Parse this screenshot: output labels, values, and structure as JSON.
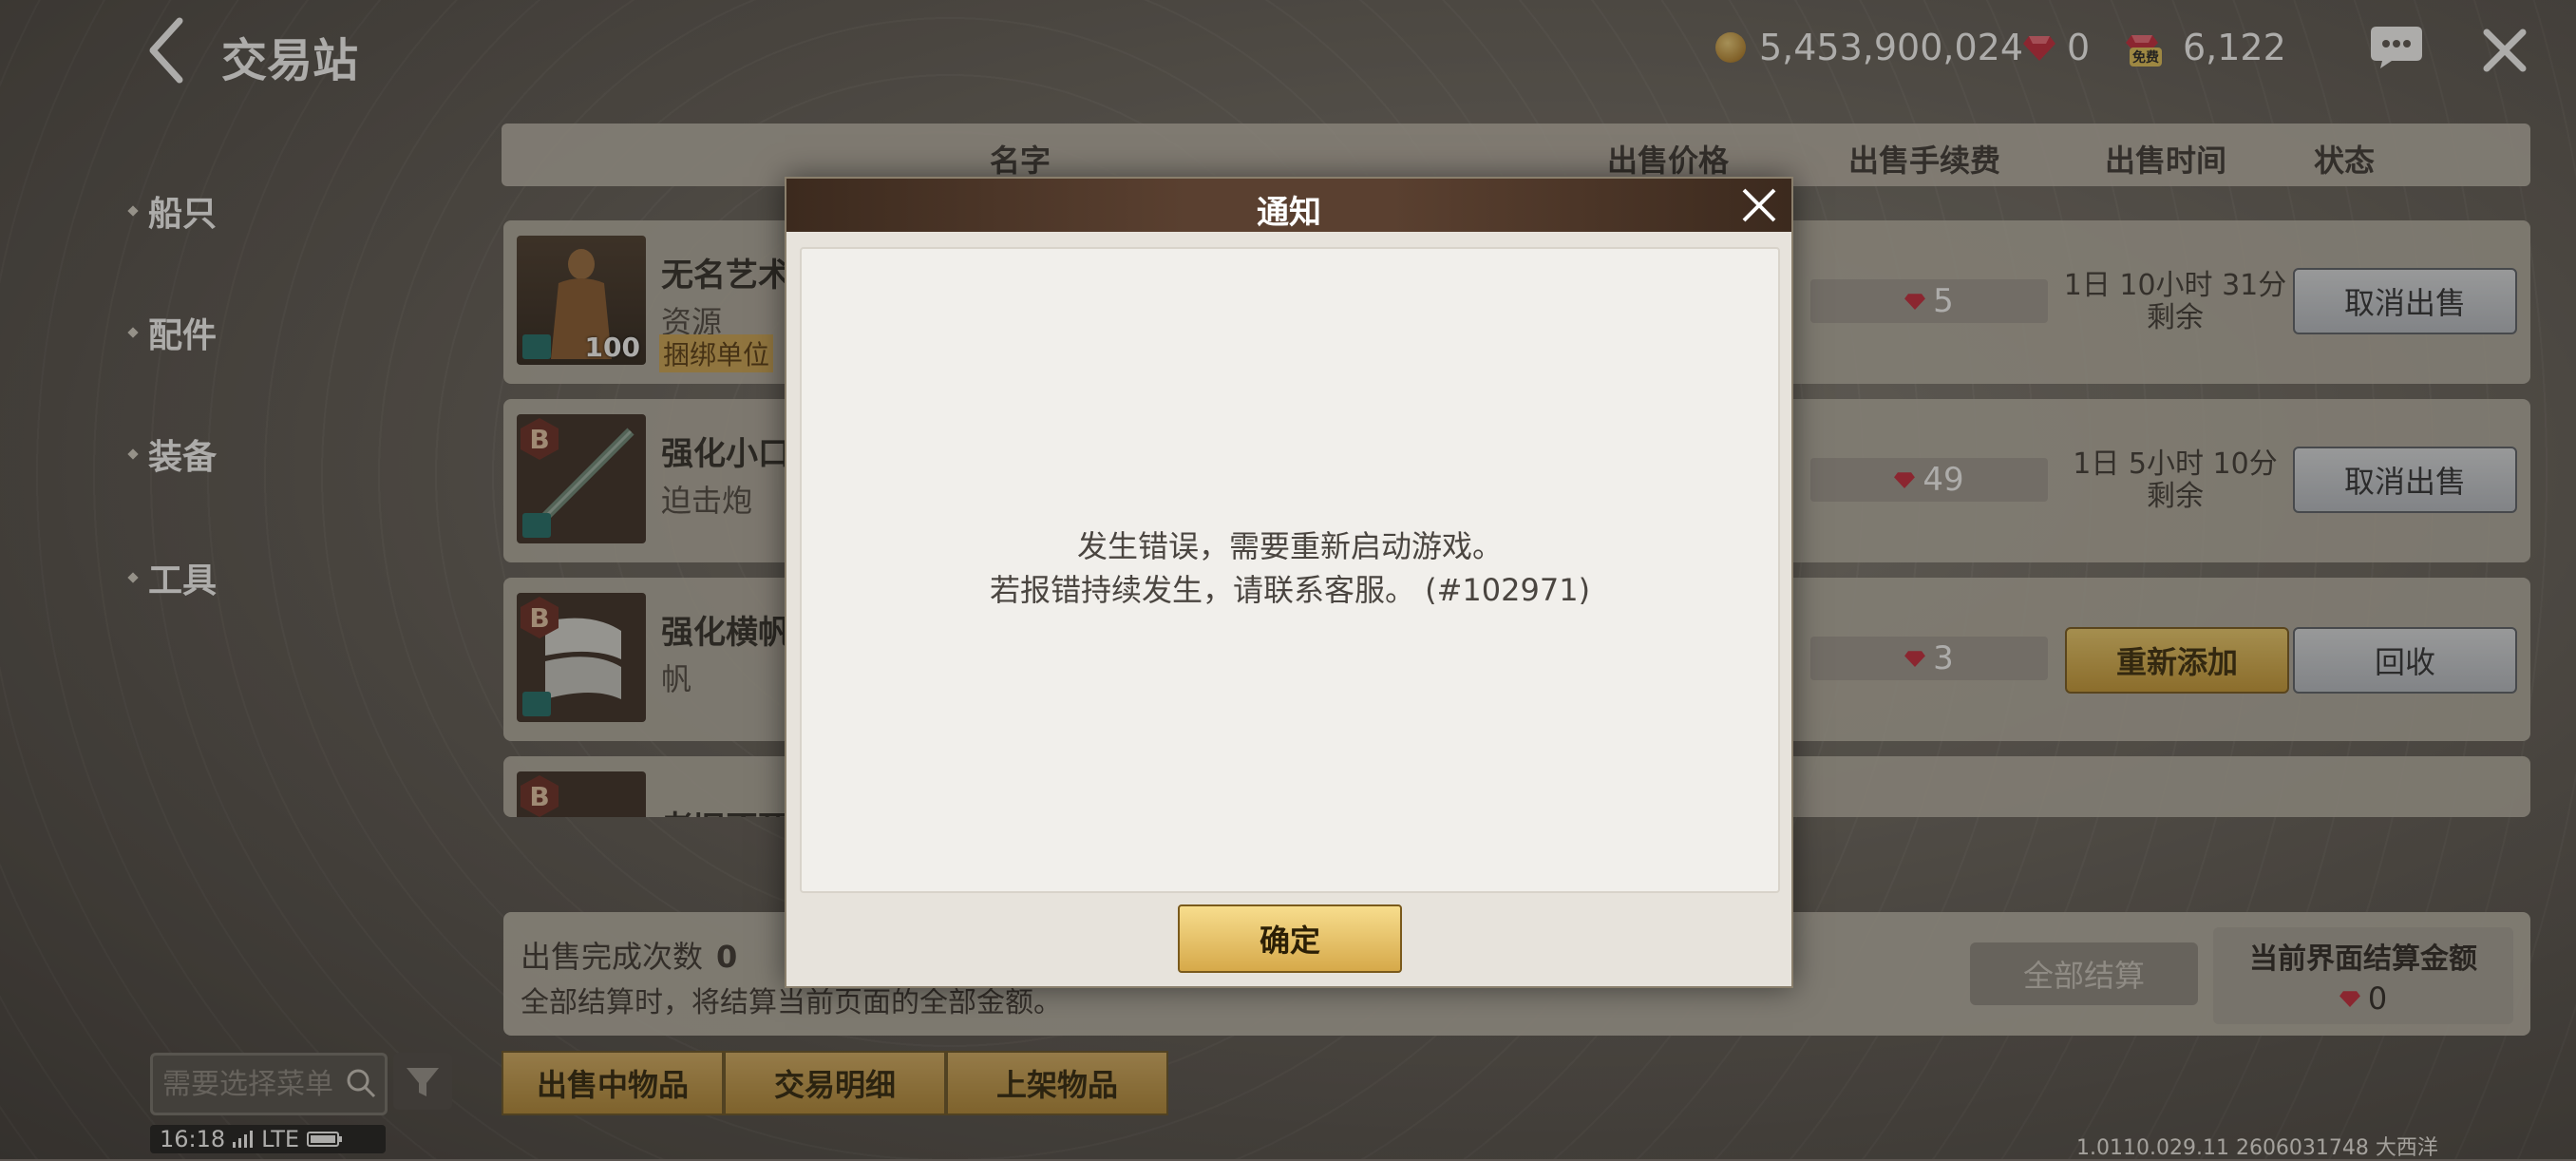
{
  "header": {
    "title": "交易站",
    "gold": "5,453,900,024",
    "gems": "0",
    "free_gems": "6,122",
    "free_tag": "免费"
  },
  "sidebar": {
    "items": [
      {
        "label": "船只"
      },
      {
        "label": "配件"
      },
      {
        "label": "装备"
      },
      {
        "label": "工具"
      }
    ]
  },
  "table": {
    "headers": {
      "name": "名字",
      "price": "出售价格",
      "fee": "出售手续费",
      "time": "出售时间",
      "status": "状态"
    },
    "rows": [
      {
        "name": "无名艺术",
        "type": "资源",
        "bind": "捆绑单位",
        "qty": "100",
        "badge": "",
        "fee": "5",
        "time": "1日 10小时 31分 剩余",
        "btn1": "",
        "btn2": "取消出售"
      },
      {
        "name": "强化小口",
        "type": "迫击炮",
        "bind": "",
        "qty": "",
        "badge": "B",
        "fee": "49",
        "time": "1日 5小时 10分 剩余",
        "btn1": "",
        "btn2": "取消出售"
      },
      {
        "name": "强化横帆",
        "type": "帆",
        "bind": "",
        "qty": "",
        "badge": "B",
        "fee": "3",
        "time": "",
        "btn1": "重新添加",
        "btn2": "回收"
      },
      {
        "name": "老旧不死",
        "type": "",
        "bind": "",
        "qty": "",
        "badge": "B",
        "fee": "",
        "time": "",
        "btn1": "",
        "btn2": ""
      }
    ]
  },
  "summary": {
    "sold_label": "出售完成次数",
    "sold_count": "0",
    "note": "全部结算时，将结算当前页面的全部金额。",
    "settle_all": "全部结算",
    "current_label": "当前界面结算金额",
    "current_value": "0"
  },
  "search": {
    "placeholder": "需要选择菜单"
  },
  "tabs": [
    {
      "label": "出售中物品"
    },
    {
      "label": "交易明细"
    },
    {
      "label": "上架物品"
    }
  ],
  "statusbar": {
    "time": "16:18",
    "network": "LTE"
  },
  "version": "1.0110.029.11 2606031748 大西洋",
  "modal": {
    "title": "通知",
    "line1": "发生错误，需要重新启动游戏。",
    "line2": "若报错持续发生，请联系客服。 (#102971)",
    "ok": "确定"
  }
}
